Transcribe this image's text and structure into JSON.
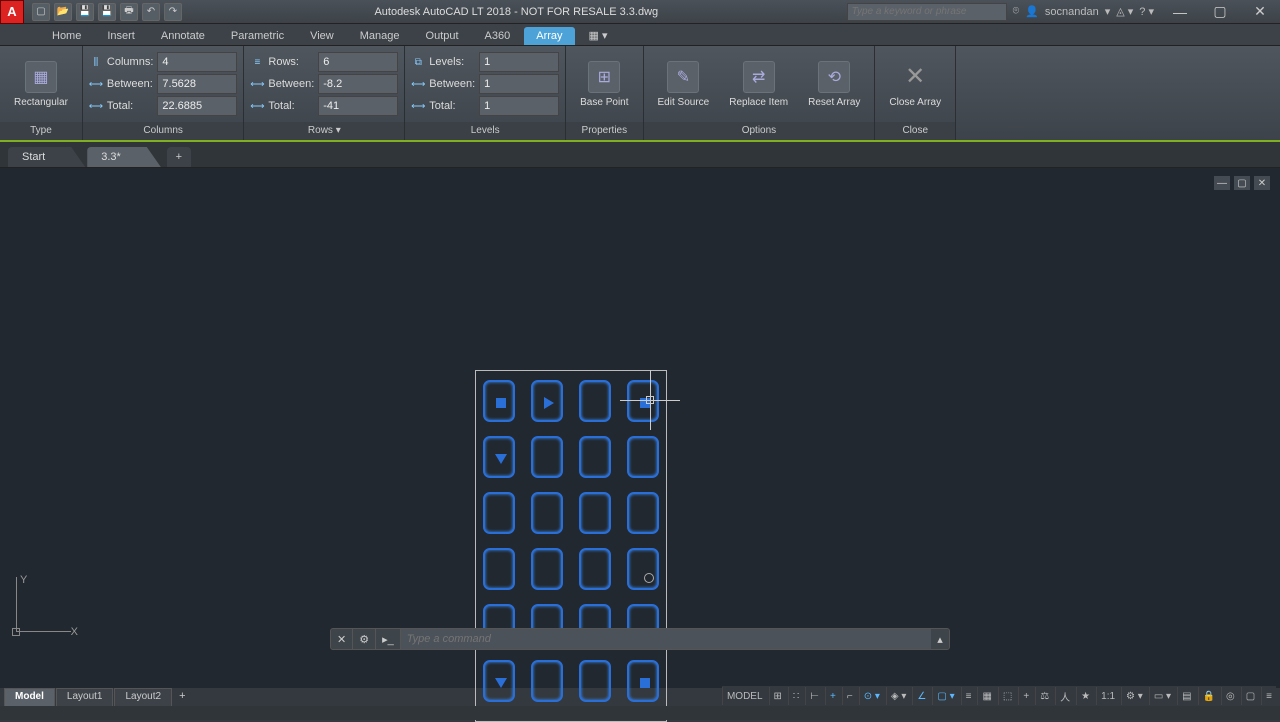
{
  "title": "Autodesk AutoCAD LT 2018 - NOT FOR RESALE   3.3.dwg",
  "app_letter": "A",
  "search_placeholder": "Type a keyword or phrase",
  "user_name": "socnandan",
  "ribbon_tabs": [
    "Home",
    "Insert",
    "Annotate",
    "Parametric",
    "View",
    "Manage",
    "Output",
    "A360",
    "Array"
  ],
  "active_contextual_tab": "Array",
  "panels": {
    "type": {
      "title": "Type",
      "btn": "Rectangular"
    },
    "columns": {
      "title": "Columns",
      "rows": [
        {
          "label": "Columns:",
          "value": "4"
        },
        {
          "label": "Between:",
          "value": "7.5628"
        },
        {
          "label": "Total:",
          "value": "22.6885"
        }
      ]
    },
    "rows": {
      "title": "Rows  ▾",
      "rows": [
        {
          "label": "Rows:",
          "value": "6"
        },
        {
          "label": "Between:",
          "value": "-8.2"
        },
        {
          "label": "Total:",
          "value": "-41"
        }
      ]
    },
    "levels": {
      "title": "Levels",
      "rows": [
        {
          "label": "Levels:",
          "value": "1"
        },
        {
          "label": "Between:",
          "value": "1"
        },
        {
          "label": "Total:",
          "value": "1"
        }
      ]
    },
    "properties": {
      "title": "Properties",
      "btns": [
        "Base Point"
      ]
    },
    "options": {
      "title": "Options",
      "btns": [
        "Edit Source",
        "Replace Item",
        "Reset Array"
      ]
    },
    "close": {
      "title": "Close",
      "btn": "Close Array"
    }
  },
  "file_tabs": {
    "start": "Start",
    "current": "3.3*"
  },
  "ucs": {
    "x": "X",
    "y": "Y"
  },
  "cmd_placeholder": "Type a command",
  "layout_tabs": [
    "Model",
    "Layout1",
    "Layout2"
  ],
  "status": {
    "model": "MODEL",
    "scale": "1:1"
  },
  "array": {
    "cols": 4,
    "rows": 6
  }
}
